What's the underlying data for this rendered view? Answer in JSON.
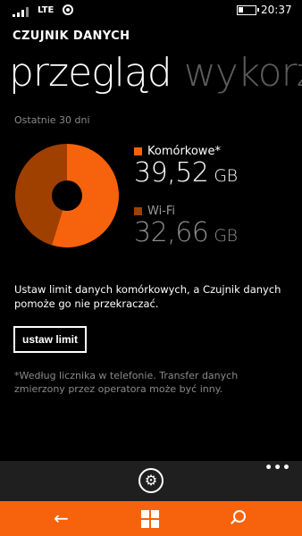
{
  "status": {
    "network": "LTE",
    "time": "20:37"
  },
  "app_title": "CZUJNIK DANYCH",
  "pivot": {
    "active": "przegląd",
    "inactive": "wykorz"
  },
  "period": "Ostatnie 30 dni",
  "chart_data": {
    "type": "pie",
    "labels": [
      "Komórkowe*",
      "Wi-Fi"
    ],
    "values": [
      39.52,
      32.66
    ],
    "unit": "GB",
    "colors": [
      "#f7630c",
      "#a04000"
    ]
  },
  "legend": {
    "cellular": {
      "label": "Komórkowe*",
      "value": "39,52",
      "unit": "GB",
      "color": "#f7630c"
    },
    "wifi": {
      "label": "Wi-Fi",
      "value": "32,66",
      "unit": "GB",
      "color": "#a04000"
    }
  },
  "info_text": "Ustaw limit danych komórkowych, a Czujnik danych pomoże go nie przekraczać.",
  "set_limit_button": "ustaw limit",
  "footnote": "*Według licznika w telefonie. Transfer danych zmierzony przez operatora może być inny.",
  "appbar": {
    "settings_icon": "gear-icon",
    "more": "•••"
  },
  "navbar": {
    "back": "←",
    "accent": "#f7630c"
  }
}
